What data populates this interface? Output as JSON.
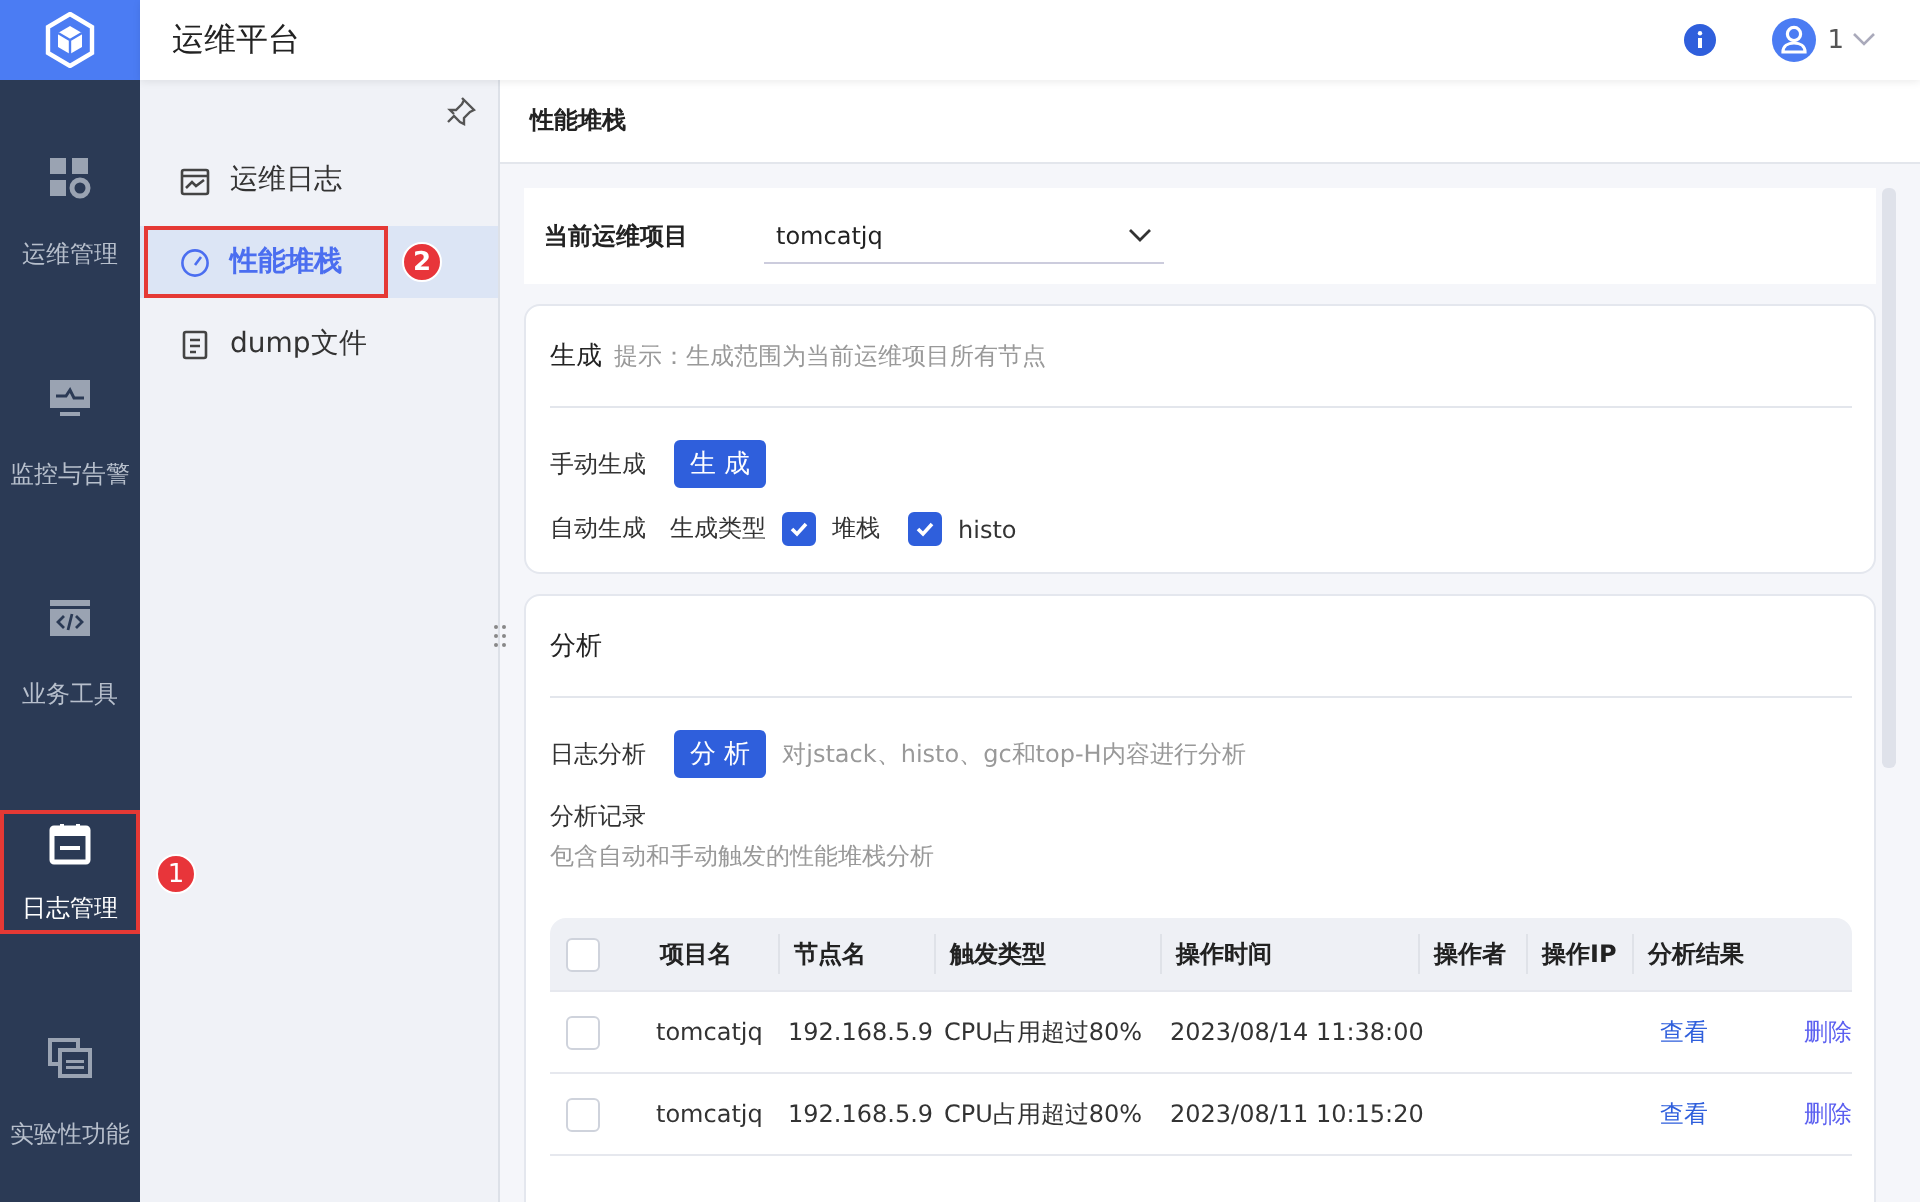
{
  "app": {
    "title": "运维平台",
    "user": "1"
  },
  "rail": [
    {
      "label": "运维管理",
      "selected": false,
      "highlighted": false
    },
    {
      "label": "监控与告警",
      "selected": false,
      "highlighted": false
    },
    {
      "label": "业务工具",
      "selected": false,
      "highlighted": false
    },
    {
      "label": "日志管理",
      "selected": true,
      "highlighted": true,
      "callout": "1"
    },
    {
      "label": "实验性功能",
      "selected": false,
      "highlighted": false
    }
  ],
  "submenu": [
    {
      "label": "运维日志",
      "selected": false,
      "highlighted": false
    },
    {
      "label": "性能堆栈",
      "selected": true,
      "highlighted": true,
      "callout": "2"
    },
    {
      "label": "dump文件",
      "selected": false,
      "highlighted": false
    }
  ],
  "page_title": "性能堆栈",
  "project": {
    "label": "当前运维项目",
    "value": "tomcatjq"
  },
  "generate": {
    "title": "生成",
    "hint": "提示：生成范围为当前运维项目所有节点",
    "manual_label": "手动生成",
    "button": "生 成",
    "auto_label": "自动生成",
    "type_label": "生成类型",
    "types": [
      {
        "label": "堆栈",
        "checked": true
      },
      {
        "label": "histo",
        "checked": true
      }
    ]
  },
  "analysis": {
    "title": "分析",
    "log_label": "日志分析",
    "button": "分 析",
    "hint": "对jstack、histo、gc和top-H内容进行分析",
    "records_title": "分析记录",
    "records_hint": "包含自动和手动触发的性能堆栈分析",
    "table": {
      "all_checked": false,
      "columns": [
        "项目名",
        "节点名",
        "触发类型",
        "操作时间",
        "操作者",
        "操作IP",
        "分析结果"
      ],
      "rows": [
        {
          "checked": false,
          "cells": [
            "tomcatjq",
            "192.168.5.9",
            "CPU占用超过80%",
            "2023/08/14 11:38:00"
          ],
          "view": "查看",
          "delete": "删除"
        },
        {
          "checked": false,
          "cells": [
            "tomcatjq",
            "192.168.5.9",
            "CPU占用超过80%",
            "2023/08/11 10:15:20"
          ],
          "view": "查看",
          "delete": "删除"
        }
      ]
    }
  }
}
